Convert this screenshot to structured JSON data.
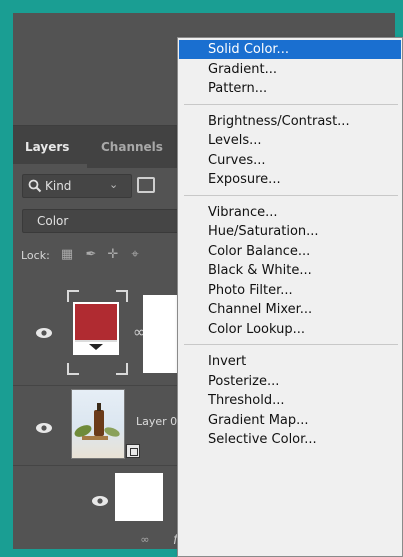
{
  "panel": {
    "tabs": [
      {
        "label": "Layers",
        "active": true
      },
      {
        "label": "Channels",
        "active": false
      }
    ],
    "filter": {
      "kind_label": "Kind",
      "icon": "search-icon"
    },
    "blend_mode": "Color",
    "lock_label": "Lock:",
    "layers": [
      {
        "name": "",
        "type": "solid-color-fill",
        "color": "#b02b31"
      },
      {
        "name": "Layer 0",
        "type": "smart-object-photo"
      },
      {
        "name": "",
        "type": "white-fill"
      }
    ],
    "footer_fx": "fx"
  },
  "menu": {
    "groups": [
      [
        "Solid Color...",
        "Gradient...",
        "Pattern..."
      ],
      [
        "Brightness/Contrast...",
        "Levels...",
        "Curves...",
        "Exposure..."
      ],
      [
        "Vibrance...",
        "Hue/Saturation...",
        "Color Balance...",
        "Black & White...",
        "Photo Filter...",
        "Channel Mixer...",
        "Color Lookup..."
      ],
      [
        "Invert",
        "Posterize...",
        "Threshold...",
        "Gradient Map...",
        "Selective Color..."
      ]
    ],
    "selected": "Solid Color..."
  },
  "colors": {
    "frame": "#1a9e93",
    "panel_bg": "#535353",
    "menu_highlight": "#1a6fd0",
    "fill_swatch": "#b02b31"
  }
}
